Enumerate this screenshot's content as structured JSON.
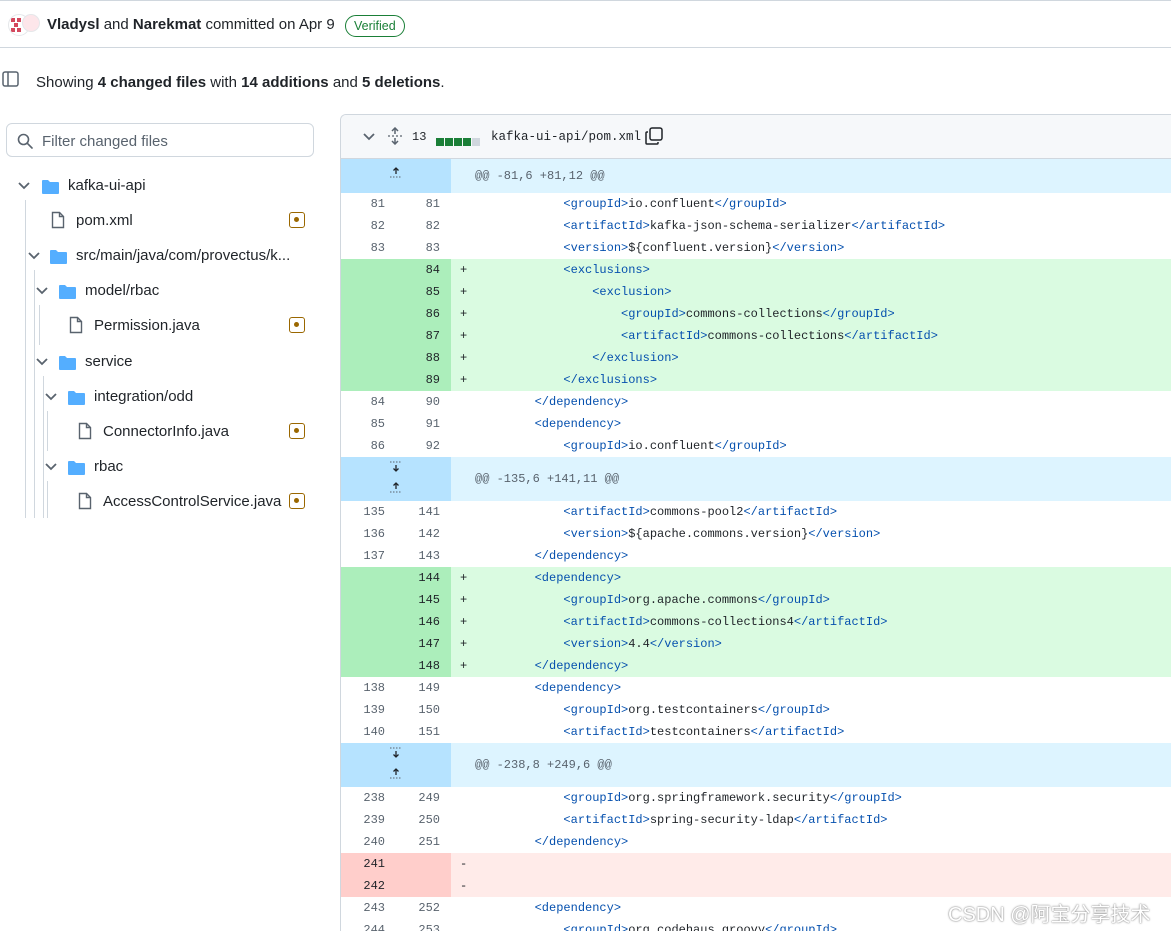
{
  "commit": {
    "author1": "Vladysl",
    "and_word": "and",
    "author2": "Narekmat",
    "committed": "committed on Apr 9",
    "verified": "Verified"
  },
  "summary": {
    "showing": "Showing",
    "files": "4 changed files",
    "with": "with",
    "additions": "14 additions",
    "and": "and",
    "deletions": "5 deletions",
    "period": "."
  },
  "filter": {
    "placeholder": "Filter changed files"
  },
  "tree": [
    {
      "label": "kafka-ui-api",
      "kind": "folder"
    },
    {
      "label": "pom.xml",
      "kind": "file",
      "status": "modified"
    },
    {
      "label": "src/main/java/com/provectus/k...",
      "kind": "folder"
    },
    {
      "label": "model/rbac",
      "kind": "folder"
    },
    {
      "label": "Permission.java",
      "kind": "file",
      "status": "modified"
    },
    {
      "label": "service",
      "kind": "folder"
    },
    {
      "label": "integration/odd",
      "kind": "folder"
    },
    {
      "label": "ConnectorInfo.java",
      "kind": "file",
      "status": "modified"
    },
    {
      "label": "rbac",
      "kind": "folder"
    },
    {
      "label": "AccessControlService.java",
      "kind": "file",
      "status": "modified"
    }
  ],
  "diff": {
    "count": "13",
    "filename": "kafka-ui-api/pom.xml",
    "hunks": [
      "@@ -81,6 +81,12 @@",
      "@@ -135,6 +141,11 @@",
      "@@ -238,8 +249,6 @@"
    ],
    "lines": [
      {
        "t": "ctx",
        "o": "81",
        "n": "81",
        "s": "",
        "c": "            <groupId>io.confluent</groupId>"
      },
      {
        "t": "ctx",
        "o": "82",
        "n": "82",
        "s": "",
        "c": "            <artifactId>kafka-json-schema-serializer</artifactId>"
      },
      {
        "t": "ctx",
        "o": "83",
        "n": "83",
        "s": "",
        "c": "            <version>${confluent.version}</version>"
      },
      {
        "t": "add",
        "o": "",
        "n": "84",
        "s": "+",
        "c": "            <exclusions>"
      },
      {
        "t": "add",
        "o": "",
        "n": "85",
        "s": "+",
        "c": "                <exclusion>"
      },
      {
        "t": "add",
        "o": "",
        "n": "86",
        "s": "+",
        "c": "                    <groupId>commons-collections</groupId>"
      },
      {
        "t": "add",
        "o": "",
        "n": "87",
        "s": "+",
        "c": "                    <artifactId>commons-collections</artifactId>"
      },
      {
        "t": "add",
        "o": "",
        "n": "88",
        "s": "+",
        "c": "                </exclusion>"
      },
      {
        "t": "add",
        "o": "",
        "n": "89",
        "s": "+",
        "c": "            </exclusions>"
      },
      {
        "t": "ctx",
        "o": "84",
        "n": "90",
        "s": "",
        "c": "        </dependency>"
      },
      {
        "t": "ctx",
        "o": "85",
        "n": "91",
        "s": "",
        "c": "        <dependency>"
      },
      {
        "t": "ctx",
        "o": "86",
        "n": "92",
        "s": "",
        "c": "            <groupId>io.confluent</groupId>"
      },
      {
        "t": "ctx",
        "o": "135",
        "n": "141",
        "s": "",
        "c": "            <artifactId>commons-pool2</artifactId>"
      },
      {
        "t": "ctx",
        "o": "136",
        "n": "142",
        "s": "",
        "c": "            <version>${apache.commons.version}</version>"
      },
      {
        "t": "ctx",
        "o": "137",
        "n": "143",
        "s": "",
        "c": "        </dependency>"
      },
      {
        "t": "add",
        "o": "",
        "n": "144",
        "s": "+",
        "c": "        <dependency>"
      },
      {
        "t": "add",
        "o": "",
        "n": "145",
        "s": "+",
        "c": "            <groupId>org.apache.commons</groupId>"
      },
      {
        "t": "add",
        "o": "",
        "n": "146",
        "s": "+",
        "c": "            <artifactId>commons-collections4</artifactId>"
      },
      {
        "t": "add",
        "o": "",
        "n": "147",
        "s": "+",
        "c": "            <version>4.4</version>"
      },
      {
        "t": "add",
        "o": "",
        "n": "148",
        "s": "+",
        "c": "        </dependency>"
      },
      {
        "t": "ctx",
        "o": "138",
        "n": "149",
        "s": "",
        "c": "        <dependency>"
      },
      {
        "t": "ctx",
        "o": "139",
        "n": "150",
        "s": "",
        "c": "            <groupId>org.testcontainers</groupId>"
      },
      {
        "t": "ctx",
        "o": "140",
        "n": "151",
        "s": "",
        "c": "            <artifactId>testcontainers</artifactId>"
      },
      {
        "t": "ctx",
        "o": "238",
        "n": "249",
        "s": "",
        "c": "            <groupId>org.springframework.security</groupId>"
      },
      {
        "t": "ctx",
        "o": "239",
        "n": "250",
        "s": "",
        "c": "            <artifactId>spring-security-ldap</artifactId>"
      },
      {
        "t": "ctx",
        "o": "240",
        "n": "251",
        "s": "",
        "c": "        </dependency>"
      },
      {
        "t": "del",
        "o": "241",
        "n": "",
        "s": "-",
        "c": ""
      },
      {
        "t": "del",
        "o": "242",
        "n": "",
        "s": "-",
        "c": ""
      },
      {
        "t": "ctx",
        "o": "243",
        "n": "252",
        "s": "",
        "c": "        <dependency>"
      },
      {
        "t": "ctx",
        "o": "244",
        "n": "253",
        "s": "",
        "c": "            <groupId>org.codehaus.groovy</groupId>"
      }
    ]
  },
  "watermark": "CSDN @阿宝分享技术",
  "colors": {
    "add_bg": "#dafbe1",
    "add_num": "#aceebb",
    "del_bg": "#ffebe9",
    "del_num": "#ffcecb",
    "hunk_bg": "#ddf4ff",
    "hunk_gutter": "#b6e3ff",
    "verified": "#1a7f37",
    "folder": "#54aeff",
    "modified": "#9a6700",
    "tag": "#0550ae"
  }
}
